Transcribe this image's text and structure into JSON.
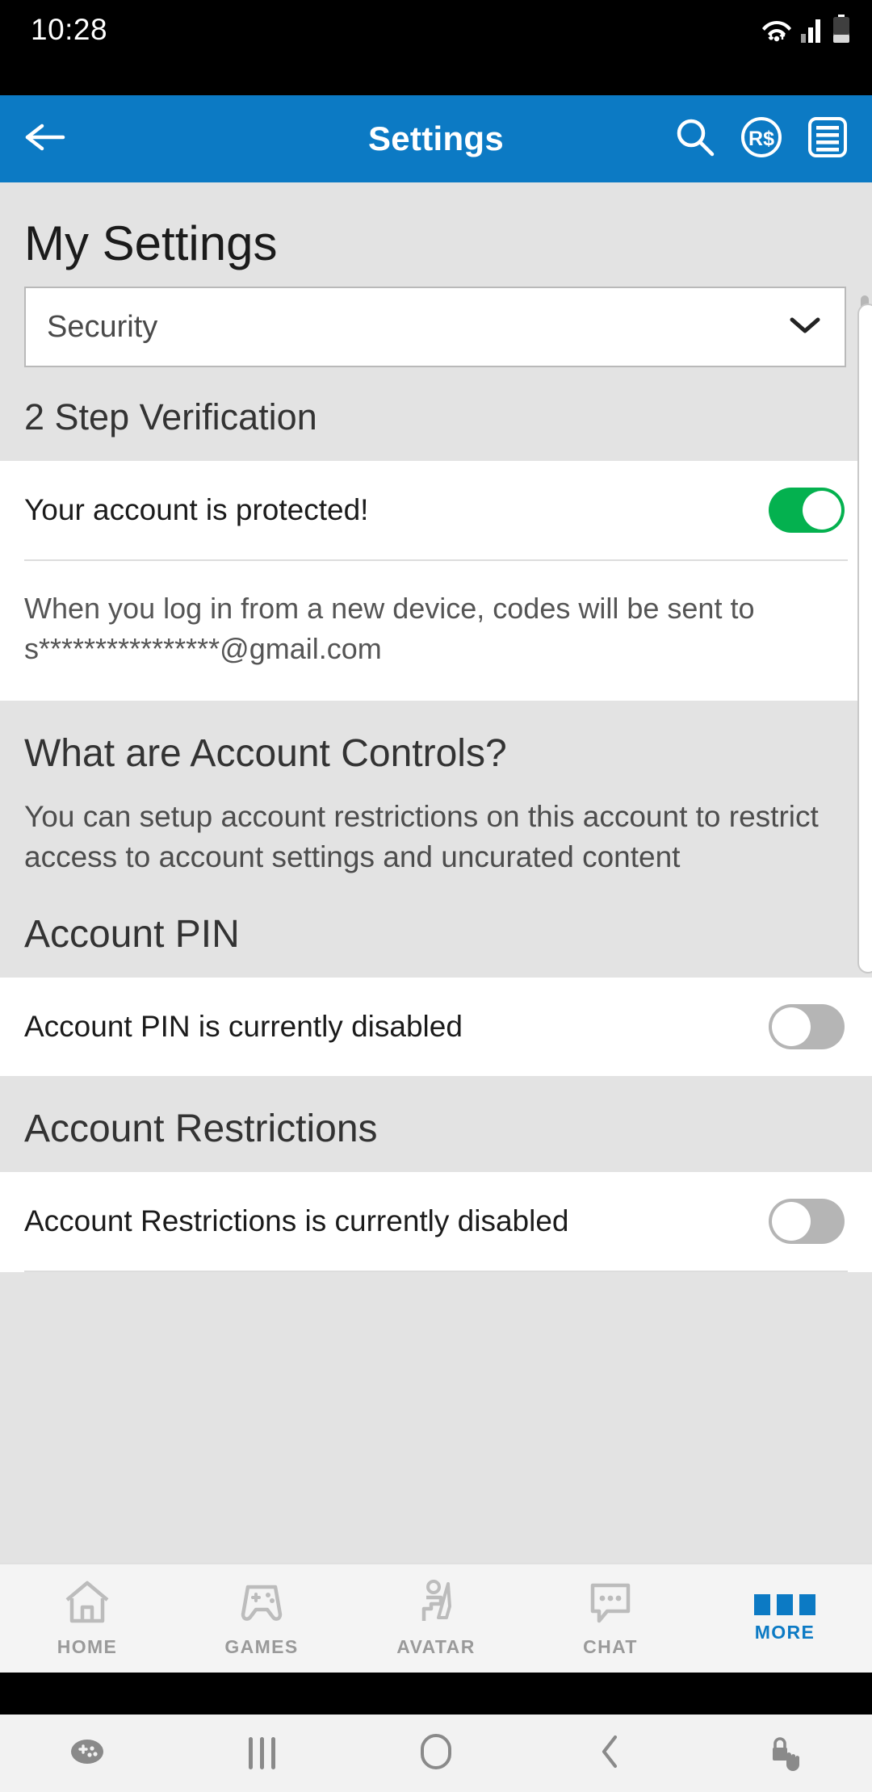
{
  "status_bar": {
    "time": "10:28",
    "icons": [
      "wifi-icon",
      "cellular-signal-icon",
      "battery-icon"
    ]
  },
  "app_bar": {
    "title": "Settings",
    "back_icon": "back-arrow-icon",
    "actions": [
      "search-icon",
      "robux-icon",
      "menu-list-icon"
    ]
  },
  "page": {
    "title": "My Settings",
    "category_select": {
      "value": "Security",
      "chevron": "chevron-down-icon"
    }
  },
  "two_step": {
    "heading": "2 Step Verification",
    "row_label": "Your account is protected!",
    "toggle_state": "on",
    "help_text": "When you log in from a new device, codes will be sent to s****************@gmail.com"
  },
  "account_controls": {
    "heading": "What are Account Controls?",
    "body": "You can setup account restrictions on this account to restrict access to account settings and uncurated content"
  },
  "account_pin": {
    "heading": "Account PIN",
    "row_label": "Account PIN is currently disabled",
    "toggle_state": "off"
  },
  "account_restrictions": {
    "heading": "Account Restrictions",
    "row_label": "Account Restrictions is currently disabled",
    "toggle_state": "off"
  },
  "tab_bar": {
    "items": [
      {
        "label": "HOME",
        "icon": "home-icon",
        "active": false
      },
      {
        "label": "GAMES",
        "icon": "gamepad-icon",
        "active": false
      },
      {
        "label": "AVATAR",
        "icon": "avatar-icon",
        "active": false
      },
      {
        "label": "CHAT",
        "icon": "chat-icon",
        "active": false
      },
      {
        "label": "MORE",
        "icon": "more-icon",
        "active": true
      }
    ]
  },
  "android_nav": {
    "items": [
      "game-booster-icon",
      "recents-icon",
      "home-circle-icon",
      "back-chevron-icon",
      "screen-lock-touch-icon"
    ]
  },
  "colors": {
    "brand_blue": "#0c7ac4",
    "toggle_on_green": "#04b14f",
    "toggle_off_grey": "#b5b5b5",
    "page_background": "#e3e3e3"
  }
}
